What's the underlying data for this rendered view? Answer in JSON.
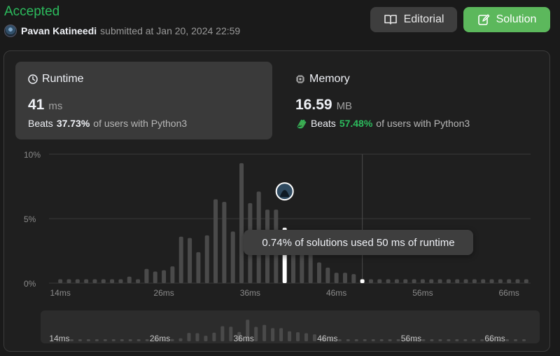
{
  "submission": {
    "status": "Accepted",
    "user": "Pavan Katineedi",
    "submitted_text": "submitted at Jan 20, 2024 22:59"
  },
  "buttons": {
    "editorial": "Editorial",
    "solution": "Solution"
  },
  "runtime": {
    "title": "Runtime",
    "value": "41",
    "unit": "ms",
    "beats_label": "Beats",
    "beats_pct": "37.73%",
    "beats_suffix": "of users with Python3"
  },
  "memory": {
    "title": "Memory",
    "value": "16.59",
    "unit": "MB",
    "beats_label": "Beats",
    "beats_pct": "57.48%",
    "beats_suffix": "of users with Python3"
  },
  "tooltip": "0.74% of solutions used 50 ms of runtime",
  "colors": {
    "accepted": "#2cbb5d",
    "solution_button": "#5cb85c",
    "beats_memory": "#2cbb5d",
    "bar": "#4a4a4a",
    "bar_highlight": "#ffffff"
  },
  "chart_data": {
    "type": "bar",
    "title": "",
    "xlabel": "",
    "ylabel": "",
    "ylim": [
      0,
      10
    ],
    "yticks": [
      "0%",
      "5%",
      "10%"
    ],
    "xticks": [
      "14ms",
      "26ms",
      "36ms",
      "46ms",
      "56ms",
      "66ms"
    ],
    "x_range_ms": [
      14,
      70
    ],
    "values": [
      0.3,
      0.3,
      0.3,
      0.3,
      0.3,
      0.3,
      0.3,
      0.3,
      0.5,
      0.3,
      1.1,
      0.9,
      1.0,
      1.3,
      3.6,
      3.5,
      2.4,
      3.7,
      6.5,
      6.3,
      4.0,
      9.3,
      6.2,
      7.1,
      5.7,
      5.7,
      4.3,
      3.9,
      3.5,
      3.0,
      1.6,
      1.2,
      0.8,
      0.8,
      0.7,
      0.3,
      0.3,
      0.3,
      0.3,
      0.3,
      0.3,
      0.3,
      0.3,
      0.3,
      0.3,
      0.3,
      0.3,
      0.3,
      0.3,
      0.3,
      0.3,
      0.3,
      0.3,
      0.3,
      0.3
    ],
    "highlight": {
      "my_runtime_index": 26,
      "my_runtime_value": 5.7,
      "hover_index": 35,
      "hover_value": 0.74
    }
  }
}
